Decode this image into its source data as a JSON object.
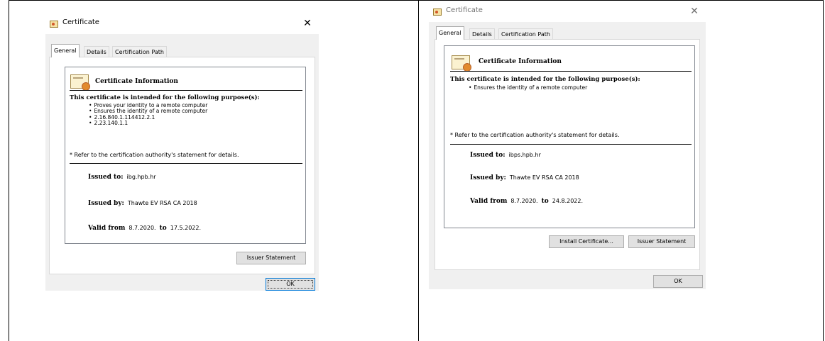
{
  "dialogs": [
    {
      "title": "Certificate",
      "close_glyph": "✕",
      "title_icon": "certificate-icon",
      "tabs": [
        "General",
        "Details",
        "Certification Path"
      ],
      "active_tab": "General",
      "info": {
        "heading": "Certificate Information",
        "purpose_title": "This certificate is intended for the following purpose(s):",
        "purposes": [
          "Proves your identity to a remote computer",
          "Ensures the identity of a remote computer",
          "2.16.840.1.114412.2.1",
          "2.23.140.1.1"
        ],
        "note": "* Refer to the certification authority's statement for details.",
        "issued_to_label": "Issued to:",
        "issued_to": "ibg.hpb.hr",
        "issued_by_label": "Issued by:",
        "issued_by": "Thawte EV RSA CA 2018",
        "valid_from_label": "Valid from",
        "valid_from": "8.7.2020.",
        "valid_to_label": "to",
        "valid_to": "17.5.2022."
      },
      "buttons": {
        "issuer_statement": "Issuer Statement",
        "ok": "OK"
      }
    },
    {
      "title": "Certificate",
      "close_glyph": "✕",
      "title_icon": "certificate-icon",
      "tabs": [
        "General",
        "Details",
        "Certification Path"
      ],
      "active_tab": "General",
      "info": {
        "heading": "Certificate Information",
        "purpose_title": "This certificate is intended for the following purpose(s):",
        "purposes": [
          "Ensures the identity of a remote computer"
        ],
        "note": "* Refer to the certification authority's statement for details.",
        "issued_to_label": "Issued to:",
        "issued_to": "ibps.hpb.hr",
        "issued_by_label": "Issued by:",
        "issued_by": "Thawte EV RSA CA 2018",
        "valid_from_label": "Valid from",
        "valid_from": "8.7.2020.",
        "valid_to_label": "to",
        "valid_to": "24.8.2022."
      },
      "buttons": {
        "install_certificate": "Install Certificate...",
        "issuer_statement": "Issuer Statement",
        "ok": "OK"
      }
    }
  ]
}
